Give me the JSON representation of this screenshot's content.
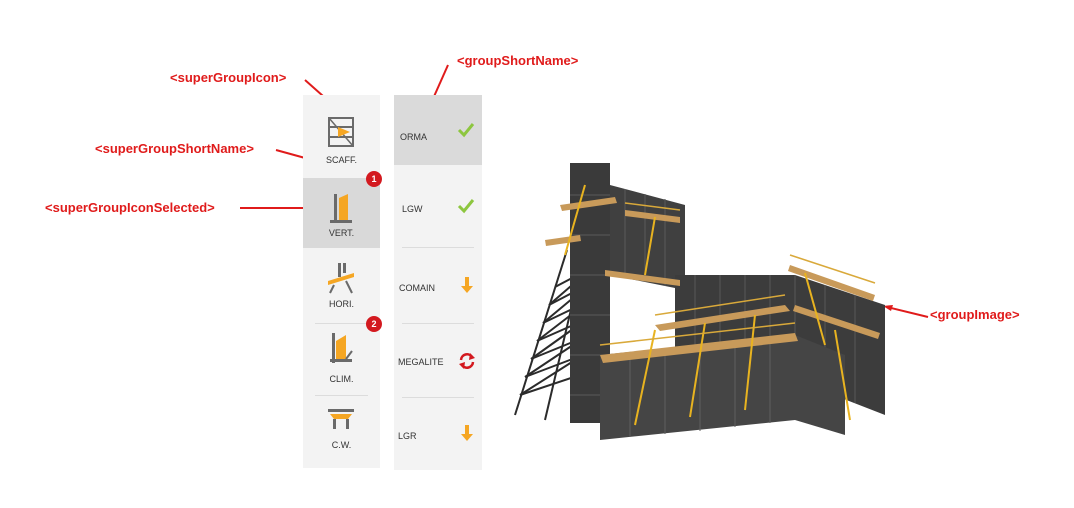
{
  "annotations": {
    "super_group_icon": "<superGroupIcon>",
    "super_group_short_name": "<superGroupShortName>",
    "super_group_icon_selected": "<superGroupIconSelected>",
    "group_short_name": "<groupShortName>",
    "group_image": "<groupImage>"
  },
  "super_groups": [
    {
      "label": "SCAFF.",
      "icon": "scaffold-icon",
      "selected": false
    },
    {
      "label": "VERT.",
      "icon": "vertical-formwork-icon",
      "selected": true,
      "badge": "1"
    },
    {
      "label": "HORI.",
      "icon": "horizontal-formwork-icon",
      "selected": false
    },
    {
      "label": "CLIM.",
      "icon": "climbing-formwork-icon",
      "selected": false,
      "badge": "2"
    },
    {
      "label": "C.W.",
      "icon": "cantilever-walkway-icon",
      "selected": false
    }
  ],
  "groups": [
    {
      "label": "ORMA",
      "status": "check-icon",
      "selected": true
    },
    {
      "label": "LGW",
      "status": "check-icon",
      "selected": false
    },
    {
      "label": "COMAIN",
      "status": "arrow-down-icon",
      "selected": false
    },
    {
      "label": "MEGALITE",
      "status": "refresh-icon",
      "selected": false
    },
    {
      "label": "LGR",
      "status": "arrow-down-icon",
      "selected": false
    }
  ],
  "colors": {
    "accent_orange": "#f5a623",
    "check_green": "#8dc63f",
    "refresh_red": "#d3191f",
    "annotation_red": "#e01b1b"
  }
}
